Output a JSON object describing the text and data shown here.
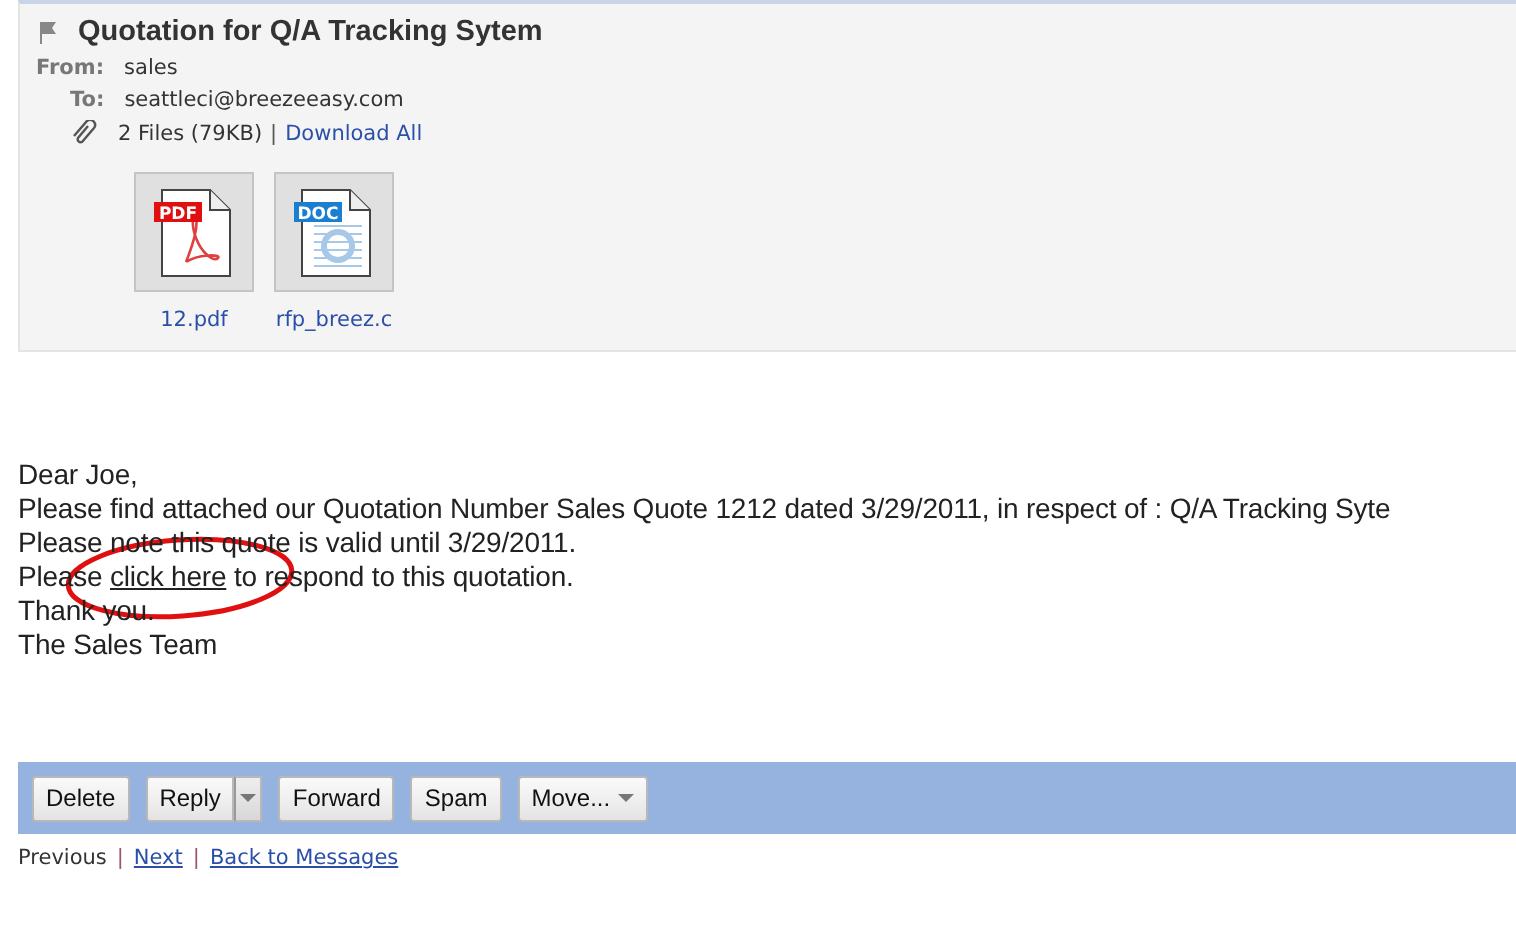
{
  "message": {
    "subject": "Quotation for Q/A Tracking Sytem",
    "from_label": "From:",
    "from": "sales",
    "to_label": "To:",
    "to": "seattleci@breezeeasy.com",
    "files_summary": "2 Files (79KB)",
    "separator": "|",
    "download_all": "Download All",
    "attachments": [
      {
        "kind": "pdf",
        "badge": "PDF",
        "name": "12.pdf"
      },
      {
        "kind": "doc",
        "badge": "DOC",
        "name": "rfp_breez.c"
      }
    ]
  },
  "body": {
    "lines": [
      {
        "text": "Dear Joe,"
      },
      {
        "text": "Please find attached our Quotation Number Sales Quote 1212 dated 3/29/2011, in respect of : Q/A Tracking Syte"
      },
      {
        "text": "Please note this quote is valid until 3/29/2011."
      },
      {
        "before": "Please",
        "link": "click here",
        "after": "to respond to this quotation.",
        "annotated": true
      },
      {
        "text": "Thank you."
      },
      {
        "text": "The Sales Team"
      }
    ]
  },
  "toolbar": [
    {
      "label": "Delete",
      "dropdown": false
    },
    {
      "label": "Reply",
      "dropdown": true
    },
    {
      "label": "Forward",
      "dropdown": false
    },
    {
      "label": "Spam",
      "dropdown": false
    },
    {
      "label": "Move...",
      "dropdown": true
    }
  ],
  "nav": [
    {
      "label": "Previous",
      "link": false
    },
    {
      "label": "Next",
      "link": true,
      "separator": "|"
    },
    {
      "label": "Back to Messages",
      "link": true,
      "separator": "|"
    }
  ]
}
